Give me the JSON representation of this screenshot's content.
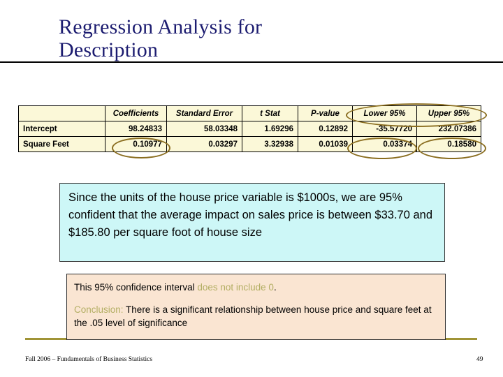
{
  "slide": {
    "title": "Regression Analysis for\nDescription",
    "accent_title_color": "#1c1c70",
    "highlight_ellipse_color": "#8a6d1f",
    "olive_text_color": "#b3ae63"
  },
  "regression_table": {
    "headers": [
      "",
      "Coefficients",
      "Standard Error",
      "t Stat",
      "P-value",
      "Lower 95%",
      "Upper 95%"
    ],
    "rows": [
      {
        "label": "Intercept",
        "coefficients": "98.24833",
        "standard_error": "58.03348",
        "t_stat": "1.69296",
        "p_value": "0.12892",
        "lower_95": "-35.57720",
        "upper_95": "232.07386"
      },
      {
        "label": "Square Feet",
        "coefficients": "0.10977",
        "standard_error": "0.03297",
        "t_stat": "3.32938",
        "p_value": "0.01039",
        "lower_95": "0.03374",
        "upper_95": "0.18580"
      }
    ]
  },
  "interpretation": {
    "text": "Since the units of the house price variable is $1000s, we are 95% confident that the average impact on sales price is between $33.70 and $185.80 per square foot of house size"
  },
  "conclusion": {
    "line1_part1": "This 95% confidence interval ",
    "line1_highlight": "does not include 0",
    "line1_part2": ".",
    "line2_highlight": "Conclusion:",
    "line2_text": " There is a significant relationship between house price and square feet at the .05 level of significance"
  },
  "footer": {
    "source": "Fall 2006 – Fundamentals of Business Statistics",
    "page": "49"
  }
}
